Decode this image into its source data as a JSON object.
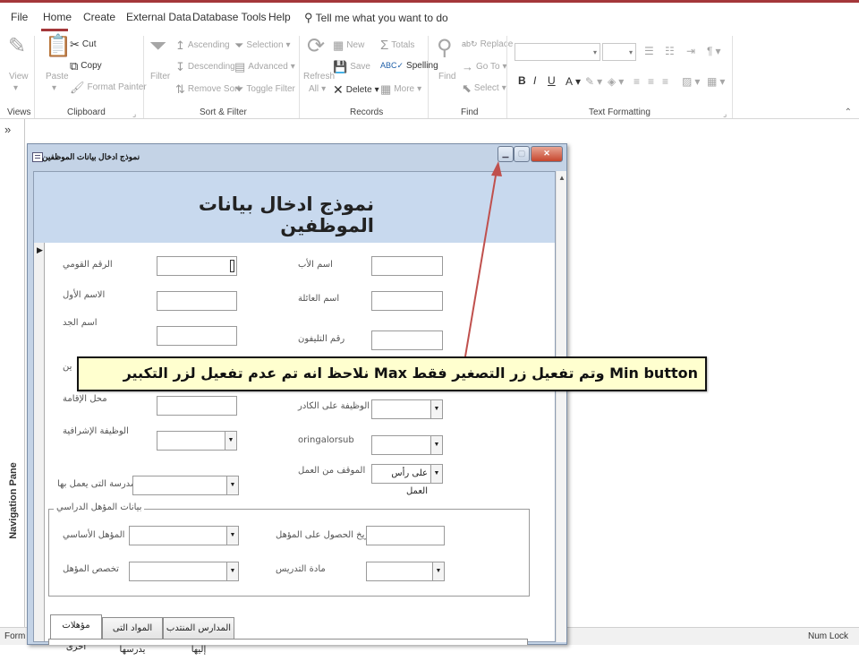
{
  "menu": {
    "tabs": [
      "File",
      "Home",
      "Create",
      "External Data",
      "Database Tools",
      "Help"
    ],
    "tell_me": "Tell me what you want to do"
  },
  "ribbon": {
    "groups": {
      "views": "Views",
      "clipboard": "Clipboard",
      "sort_filter": "Sort & Filter",
      "records": "Records",
      "find": "Find",
      "text_formatting": "Text Formatting"
    },
    "view": "View",
    "paste": "Paste",
    "cut": "Cut",
    "copy": "Copy",
    "format_painter": "Format Painter",
    "filter": "Filter",
    "ascending": "Ascending",
    "descending": "Descending",
    "remove_sort": "Remove Sort",
    "selection": "Selection",
    "advanced": "Advanced",
    "toggle_filter": "Toggle Filter",
    "refresh": "Refresh",
    "refresh_sub": "All",
    "new": "New",
    "save": "Save",
    "delete": "Delete",
    "totals": "Totals",
    "spelling": "Spelling",
    "more": "More",
    "find": "Find",
    "replace": "Replace",
    "goto": "Go To",
    "select": "Select",
    "bold": "B",
    "italic": "I",
    "underline": "U"
  },
  "nav_pane": {
    "label": "Navigation Pane",
    "chevron": "»"
  },
  "status": {
    "left": "Form Vi",
    "right": "Num Lock"
  },
  "form": {
    "window_title": "نموذج ادخال بيانات الموظفين",
    "heading": "نموذج ادخال بيانات الموظفين",
    "labels": {
      "national_id": "الرقم القومي",
      "father_name": "اسم الأب",
      "first_name": "الاسم الأول",
      "family_name": "اسم العائلة",
      "grandfather_name": "اسم الجد",
      "phone": "رقم التليفون",
      "residence": "محل الإقامة",
      "job_cadre": "الوظيفة على الكادر",
      "supervisory_job": "الوظيفة الإشرافية",
      "subform_field": "oringalorsub",
      "work_status": "الموقف من العمل",
      "school": "المدرسة التى يعمل بها",
      "main_qualification": "المؤهل الأساسي",
      "qualification_date": "تاريخ الحصول على المؤهل",
      "specialization": "تخصص المؤهل",
      "teaching_subject": "مادة التدريس",
      "partial_hidden": "ين"
    },
    "fieldset_legend": "بيانات المؤهل الدراسي",
    "work_status_value": "على رأس العمل",
    "tabs": [
      "مؤهلات اخرى",
      "المواد التى يدرسها",
      "المدارس المنتدب إليها"
    ]
  },
  "callout": {
    "text": "نلاحظ انه تم عدم تفعيل  لزر التكبير Max وتم تفعيل زر التصغير فقط Min button"
  },
  "colors": {
    "accent": "#a4373a",
    "header_band": "#c8d9ee",
    "callout_bg": "#ffffcf",
    "arrow": "#c0504d"
  }
}
